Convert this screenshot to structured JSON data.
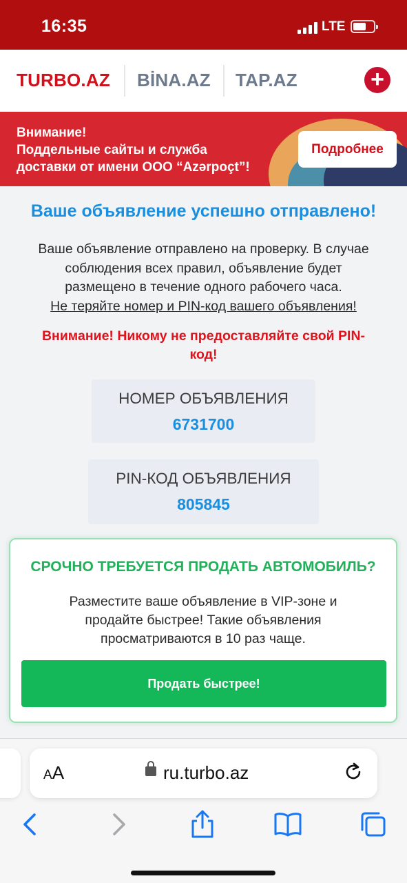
{
  "status_bar": {
    "time": "16:35",
    "network": "LTE"
  },
  "site_nav": {
    "sites": [
      {
        "label": "TURBO.AZ"
      },
      {
        "label": "BİNA.AZ"
      },
      {
        "label": "TAP.AZ"
      }
    ],
    "add_icon": "plus-icon"
  },
  "banner": {
    "line1": "Внимание!",
    "line2": "Поддельные сайты и служба",
    "line3": "доставки от имени ООО “Azərpoçt”!",
    "button_label": "Подробнее"
  },
  "main": {
    "title": "Ваше объявление успешно отправлено!",
    "desc_line1": "Ваше объявление отправлено на проверку. В случае",
    "desc_line2": "соблюдения всех правил, объявление будет",
    "desc_line3": "размещено в течение одного рабочего часа.",
    "desc_line4": "Не теряйте номер и PIN-код вашего объявления!",
    "warning_line1": "Внимание! Никому не предоставляйте свой PIN-",
    "warning_line2": "код!",
    "ad_number_label": "НОМЕР ОБЪЯВЛЕНИЯ",
    "ad_number_value": "6731700",
    "pin_label": "PIN-КОД ОБЪЯВЛЕНИЯ",
    "pin_value": "805845"
  },
  "promo": {
    "title": "СРОЧНО ТРЕБУЕТСЯ ПРОДАТЬ АВТОМОБИЛЬ?",
    "text_line1": "Разместите ваше объявление в VIP-зоне и",
    "text_line2": "продайте быстрее! Такие объявления",
    "text_line3": "просматриваются в 10 раз чаще.",
    "button_label": "Продать быстрее!"
  },
  "browser": {
    "aa_label_small": "A",
    "aa_label_big": "A",
    "url": "ru.turbo.az",
    "toolbar_icons": [
      "back-icon",
      "forward-icon",
      "share-icon",
      "bookmarks-icon",
      "tabs-icon"
    ]
  },
  "colors": {
    "brand_red": "#d0111b",
    "status_red": "#b10e10",
    "accent_blue": "#1a8fe0",
    "success_green": "#14b859"
  }
}
